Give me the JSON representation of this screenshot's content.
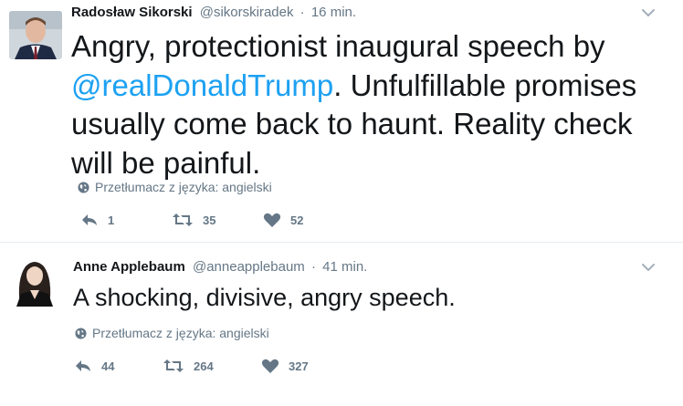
{
  "tweets": [
    {
      "author_name": "Radosław Sikorski",
      "handle": "@sikorskiradek",
      "separator": "·",
      "time": "16 min.",
      "text_before": "Angry, protectionist inaugural speech by ",
      "mention": "@realDonaldTrump",
      "text_after": ". Unfulfillable promises usually come back to haunt. Reality check will be painful.",
      "translate_label": "Przetłumacz z języka: angielski",
      "reply_count": "1",
      "retweet_count": "35",
      "like_count": "52"
    },
    {
      "author_name": "Anne Applebaum",
      "handle": "@anneapplebaum",
      "separator": "·",
      "time": "41 min.",
      "text_before": "A shocking, divisive, angry speech.",
      "translate_label": "Przetłumacz z języka: angielski",
      "reply_count": "44",
      "retweet_count": "264",
      "like_count": "327"
    }
  ],
  "icons": {
    "reply": "reply-icon",
    "retweet": "retweet-icon",
    "like": "heart-icon",
    "more": "chevron-down-icon",
    "translate": "globe-icon"
  },
  "colors": {
    "text": "#14171a",
    "secondary": "#657786",
    "mention": "#1da1f2",
    "divider": "#e6ecf0"
  }
}
